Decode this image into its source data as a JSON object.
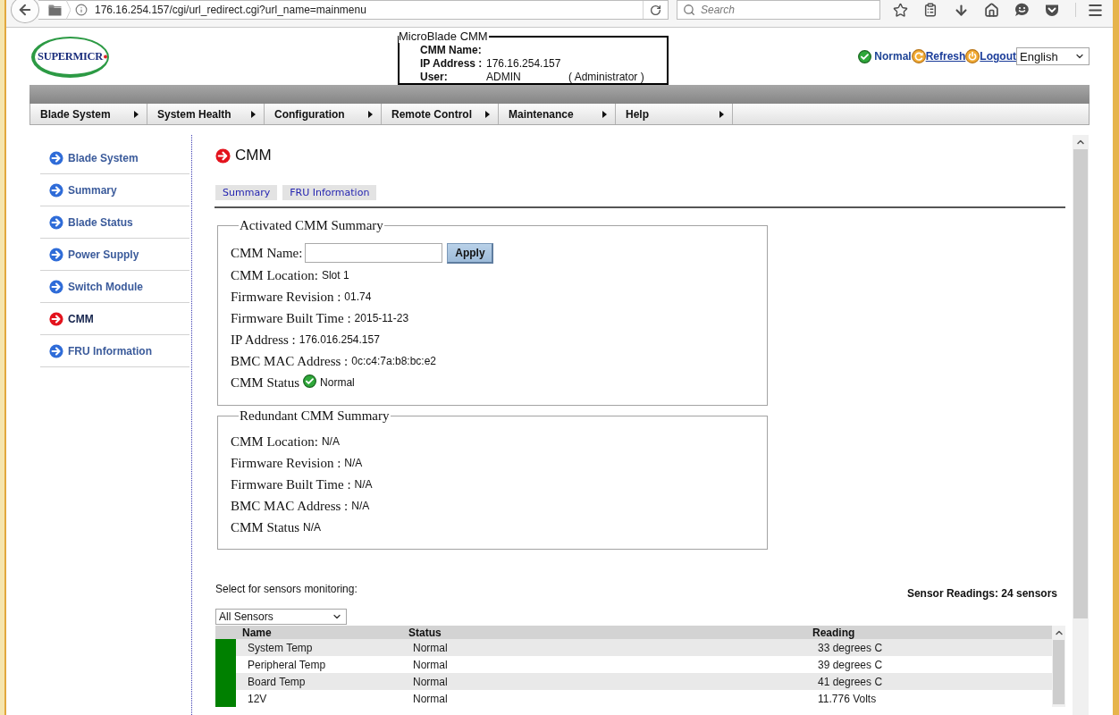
{
  "browser": {
    "url": "176.16.254.157/cgi/url_redirect.cgi?url_name=mainmenu",
    "search": {
      "placeholder": "Search"
    }
  },
  "header": {
    "logo": "SUPERMICR",
    "info": {
      "title": "MicroBlade CMM",
      "rows": [
        {
          "label": "CMM Name:"
        },
        {
          "label": "IP Address :",
          "value": "176.16.254.157"
        },
        {
          "label": "User:",
          "value": "ADMIN",
          "role": "( Administrator )"
        }
      ]
    },
    "health": "Normal",
    "links": [
      {
        "kind": "refresh",
        "label": "Refresh"
      },
      {
        "kind": "logout",
        "label": "Logout"
      }
    ],
    "language": "English"
  },
  "menu": [
    "Blade System",
    "System Health",
    "Configuration",
    "Remote Control",
    "Maintenance",
    "Help"
  ],
  "sidebar": {
    "items": [
      {
        "label": "Blade System",
        "selected": false
      },
      {
        "label": "Summary",
        "selected": false
      },
      {
        "label": "Blade Status",
        "selected": false
      },
      {
        "label": "Power Supply",
        "selected": false
      },
      {
        "label": "Switch Module",
        "selected": false
      },
      {
        "label": "CMM",
        "selected": true
      },
      {
        "label": "FRU Information",
        "selected": false
      }
    ]
  },
  "page": {
    "title": "CMM",
    "tabs": [
      "Summary",
      "FRU Information"
    ],
    "summaries": [
      {
        "legend": "Activated CMM Summary",
        "name_field": {
          "label": "CMM Name:",
          "button": "Apply"
        },
        "rows": [
          {
            "kind": "text",
            "label": "CMM Location:",
            "value": "Slot 1"
          },
          {
            "kind": "text",
            "label": "Firmware Revision :",
            "value": "01.74"
          },
          {
            "kind": "text",
            "label": "Firmware Built Time :",
            "value": "2015-11-23"
          },
          {
            "kind": "text",
            "label": "IP Address :",
            "value": "176.016.254.157"
          },
          {
            "kind": "text",
            "label": "BMC MAC Address :",
            "value": "0c:c4:7a:b8:bc:e2"
          },
          {
            "kind": "status",
            "label": "CMM Status",
            "value": "Normal"
          }
        ]
      },
      {
        "legend": "Redundant CMM Summary",
        "rows": [
          {
            "kind": "text",
            "label": "CMM Location:",
            "value": "N/A"
          },
          {
            "kind": "text",
            "label": "Firmware Revision :",
            "value": "N/A"
          },
          {
            "kind": "text",
            "label": "Firmware Built Time :",
            "value": "N/A"
          },
          {
            "kind": "text",
            "label": "BMC MAC Address :",
            "value": "N/A"
          },
          {
            "kind": "text",
            "label": "CMM Status",
            "value": "N/A"
          }
        ]
      }
    ],
    "sensors": {
      "prompt": "Select for sensors monitoring:",
      "count": "Sensor Readings: 24 sensors",
      "filter": "All Sensors",
      "columns": [
        "Name",
        "Status",
        "Reading"
      ],
      "rows": [
        {
          "name": "System Temp",
          "status": "Normal",
          "reading": "33 degrees C",
          "color": "#008000"
        },
        {
          "name": "Peripheral Temp",
          "status": "Normal",
          "reading": "39 degrees C",
          "color": "#008000"
        },
        {
          "name": "Board Temp",
          "status": "Normal",
          "reading": "41 degrees C",
          "color": "#008000"
        },
        {
          "name": "12V",
          "status": "Normal",
          "reading": "11.776 Volts",
          "color": "#008000"
        }
      ]
    }
  }
}
